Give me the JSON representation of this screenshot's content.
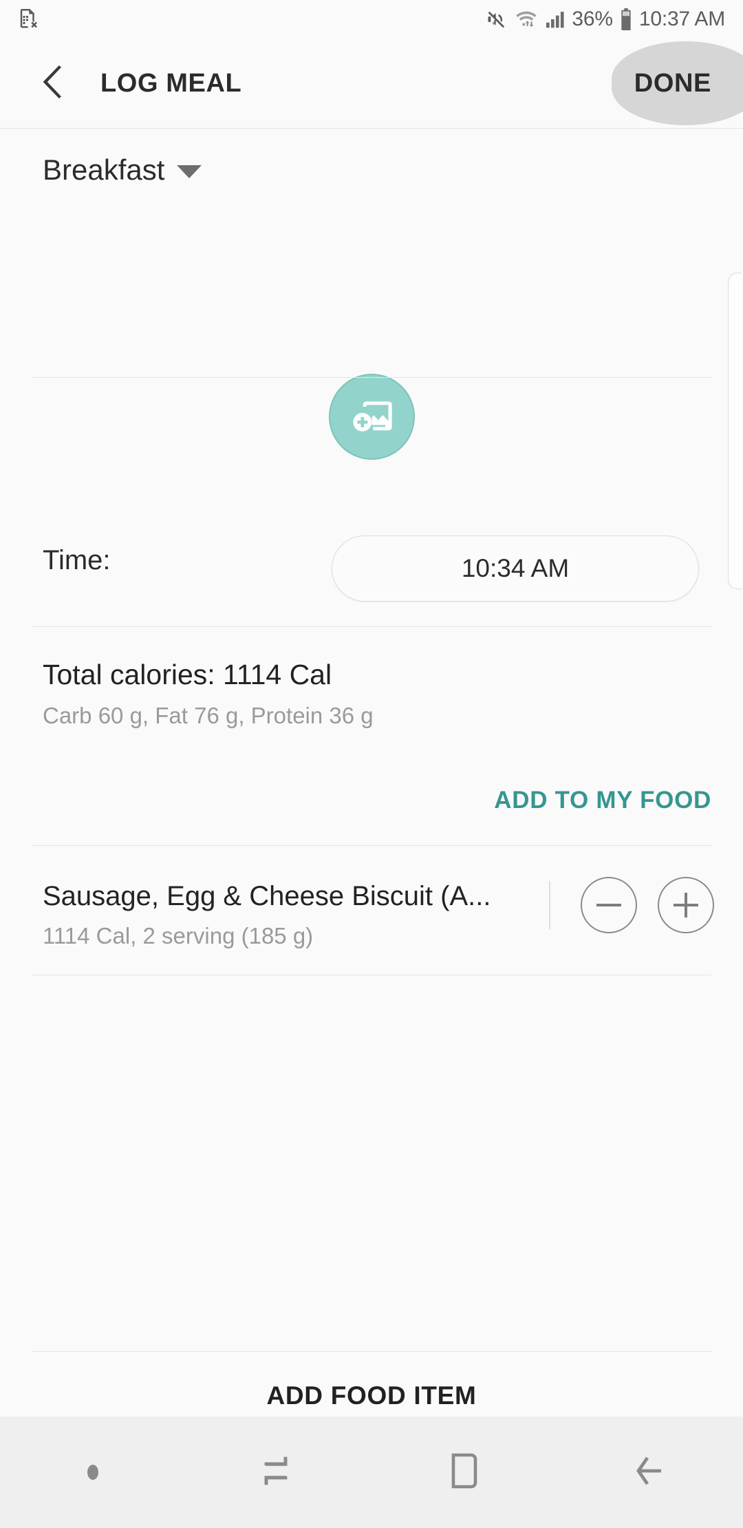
{
  "statusbar": {
    "left_icons": [
      {
        "name": "no-sim-card-icon"
      }
    ],
    "right_icons": [
      {
        "name": "mute-icon"
      },
      {
        "name": "wifi-icon"
      },
      {
        "name": "signal-bars-icon"
      },
      {
        "name": "battery-icon"
      }
    ],
    "battery_percent": "36%",
    "clock": "10:37 AM"
  },
  "appbar": {
    "back_icon": "back-chevron-icon",
    "title": "LOG MEAL",
    "done_label": "DONE"
  },
  "meal": {
    "type_label": "Breakfast",
    "dropdown_icon": "chevron-down-icon",
    "photo_icon": "add-photo-icon"
  },
  "time": {
    "label": "Time:",
    "value": "10:34 AM"
  },
  "calories": {
    "total": "Total calories: 1114 Cal",
    "macros": "Carb 60 g, Fat 76 g, Protein 36 g",
    "add_to_my_food": "ADD TO MY FOOD"
  },
  "food_items": [
    {
      "name": "Sausage, Egg & Cheese Biscuit (A...",
      "detail": "1114 Cal, 2 serving (185 g)",
      "decrease_icon": "minus-circle-icon",
      "increase_icon": "plus-circle-icon"
    }
  ],
  "footer": {
    "add_food_item": "ADD FOOD ITEM"
  },
  "navbar": {
    "items": [
      {
        "name": "nav-dot-indicator"
      },
      {
        "name": "nav-recents-icon"
      },
      {
        "name": "nav-home-icon"
      },
      {
        "name": "nav-back-icon"
      }
    ]
  },
  "colors": {
    "accent_teal": "#369690",
    "photo_circle": "#92d4cc",
    "background": "#fafafa",
    "navbar": "#efefef"
  }
}
